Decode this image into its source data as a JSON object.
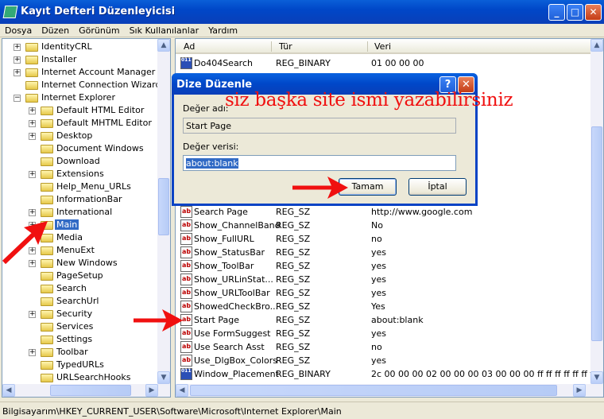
{
  "window": {
    "title": "Kayıt Defteri Düzenleyicisi",
    "min": "_",
    "max": "□",
    "close": "✕"
  },
  "menu": [
    "Dosya",
    "Düzen",
    "Görünüm",
    "Sık Kullanılanlar",
    "Yardım"
  ],
  "tree": [
    {
      "label": "IdentityCRL",
      "level": 1,
      "exp": "+"
    },
    {
      "label": "Installer",
      "level": 1,
      "exp": "+"
    },
    {
      "label": "Internet Account Manager",
      "level": 1,
      "exp": "+"
    },
    {
      "label": "Internet Connection Wizard",
      "level": 1,
      "exp": ""
    },
    {
      "label": "Internet Explorer",
      "level": 1,
      "exp": "-"
    },
    {
      "label": "Default HTML Editor",
      "level": 2,
      "exp": "+"
    },
    {
      "label": "Default MHTML Editor",
      "level": 2,
      "exp": "+"
    },
    {
      "label": "Desktop",
      "level": 2,
      "exp": "+"
    },
    {
      "label": "Document Windows",
      "level": 2,
      "exp": ""
    },
    {
      "label": "Download",
      "level": 2,
      "exp": ""
    },
    {
      "label": "Extensions",
      "level": 2,
      "exp": "+"
    },
    {
      "label": "Help_Menu_URLs",
      "level": 2,
      "exp": ""
    },
    {
      "label": "InformationBar",
      "level": 2,
      "exp": ""
    },
    {
      "label": "International",
      "level": 2,
      "exp": "+"
    },
    {
      "label": "Main",
      "level": 2,
      "exp": "+",
      "selected": true
    },
    {
      "label": "Media",
      "level": 2,
      "exp": ""
    },
    {
      "label": "MenuExt",
      "level": 2,
      "exp": "+"
    },
    {
      "label": "New Windows",
      "level": 2,
      "exp": "+"
    },
    {
      "label": "PageSetup",
      "level": 2,
      "exp": ""
    },
    {
      "label": "Search",
      "level": 2,
      "exp": ""
    },
    {
      "label": "SearchUrl",
      "level": 2,
      "exp": ""
    },
    {
      "label": "Security",
      "level": 2,
      "exp": "+"
    },
    {
      "label": "Services",
      "level": 2,
      "exp": ""
    },
    {
      "label": "Settings",
      "level": 2,
      "exp": ""
    },
    {
      "label": "Toolbar",
      "level": 2,
      "exp": "+"
    },
    {
      "label": "TypedURLs",
      "level": 2,
      "exp": ""
    },
    {
      "label": "URLSearchHooks",
      "level": 2,
      "exp": ""
    }
  ],
  "list": {
    "columns": [
      "Ad",
      "Tür",
      "Veri"
    ],
    "rows": [
      {
        "name": "Do404Search",
        "type": "REG_BINARY",
        "data": "01 00 00 00",
        "icon": "bin"
      },
      null,
      null,
      null,
      null,
      {
        "name": "",
        "type": "",
        "data": "ank.htm",
        "icon": ""
      },
      null,
      null,
      null,
      null,
      null,
      {
        "name": "Search Page",
        "type": "REG_SZ",
        "data": "http://www.google.com",
        "icon": "sz"
      },
      {
        "name": "Show_ChannelBand",
        "type": "REG_SZ",
        "data": "No",
        "icon": "sz"
      },
      {
        "name": "Show_FullURL",
        "type": "REG_SZ",
        "data": "no",
        "icon": "sz"
      },
      {
        "name": "Show_StatusBar",
        "type": "REG_SZ",
        "data": "yes",
        "icon": "sz"
      },
      {
        "name": "Show_ToolBar",
        "type": "REG_SZ",
        "data": "yes",
        "icon": "sz"
      },
      {
        "name": "Show_URLinStat...",
        "type": "REG_SZ",
        "data": "yes",
        "icon": "sz"
      },
      {
        "name": "Show_URLToolBar",
        "type": "REG_SZ",
        "data": "yes",
        "icon": "sz"
      },
      {
        "name": "ShowedCheckBro...",
        "type": "REG_SZ",
        "data": "Yes",
        "icon": "sz"
      },
      {
        "name": "Start Page",
        "type": "REG_SZ",
        "data": "about:blank",
        "icon": "sz"
      },
      {
        "name": "Use FormSuggest",
        "type": "REG_SZ",
        "data": "yes",
        "icon": "sz"
      },
      {
        "name": "Use Search Asst",
        "type": "REG_SZ",
        "data": "no",
        "icon": "sz"
      },
      {
        "name": "Use_DlgBox_Colors",
        "type": "REG_SZ",
        "data": "yes",
        "icon": "sz"
      },
      {
        "name": "Window_Placement",
        "type": "REG_BINARY",
        "data": "2c 00 00 00 02 00 00 00 03 00 00 00 ff ff ff ff ff ff ff ff...",
        "icon": "bin"
      }
    ]
  },
  "status": "Bilgisayarım\\HKEY_CURRENT_USER\\Software\\Microsoft\\Internet Explorer\\Main",
  "dialog": {
    "title": "Dize Düzenle",
    "help": "?",
    "close": "✕",
    "name_label": "Değer adı:",
    "name_value": "Start Page",
    "data_label": "Değer verisi:",
    "data_value": "about:blank",
    "ok": "Tamam",
    "cancel": "İptal"
  },
  "annotation": "siz başka site ismi yazabilirsiniz",
  "colors": {
    "annotation": "#f01010",
    "titlebar": "#0047c8",
    "selection": "#316ac5"
  }
}
